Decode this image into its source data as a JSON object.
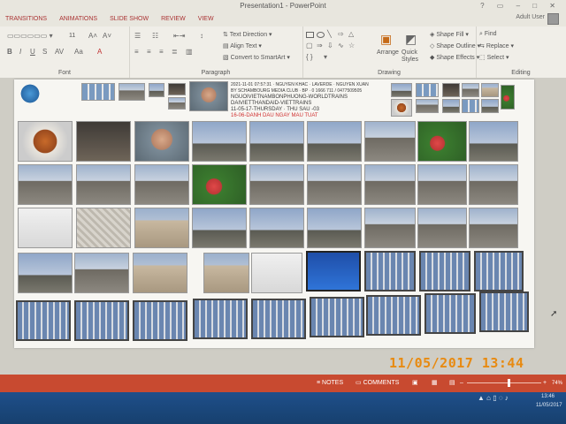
{
  "window": {
    "title": "Presentation1 - PowerPoint",
    "controls": "? ▭ – □ ✕",
    "user": "Adult User"
  },
  "ribbon_tabs": [
    "TRANSITIONS",
    "ANIMATIONS",
    "SLIDE SHOW",
    "REVIEW",
    "VIEW"
  ],
  "ribbon": {
    "font_label": "Font",
    "font_size": "11",
    "paragraph_label": "Paragraph",
    "text_direction": "Text Direction",
    "align_text": "Align Text",
    "convert_smartart": "Convert to SmartArt",
    "drawing_label": "Drawing",
    "arrange": "Arrange",
    "quick_styles": "Quick Styles",
    "shape_fill": "Shape Fill",
    "shape_outline": "Shape Outline",
    "shape_effects": "Shape Effects",
    "editing_label": "Editing",
    "find": "Find",
    "replace": "Replace",
    "select": "Select"
  },
  "slide_text": {
    "line1": "2021-11-01 07:57:31 · NGUYEN KHAC · LAVERDE · NGUYEN XUAN",
    "line2": "BY SCHAMBOURG MEDIA CLUB · BP · 0 1666 711 / 0477509505",
    "line3": "NGUOIVIETNAMBONPHUONG-WORLDTRAINS",
    "line4": "DAIVIETTHANDAID-VIETTRAINS",
    "line5": "11-05-17-THURSDAY · THU SAU -03",
    "line6": "16-06-DANH DAU NGAY MAU TUAT"
  },
  "status_bar": {
    "notes": "NOTES",
    "comments": "COMMENTS",
    "zoom": "74%"
  },
  "taskbar": {
    "time": "13:46",
    "date": "11/05/2017"
  },
  "camera_timestamp": "11/05/2017  13:44",
  "colors": {
    "accent": "#c84a30",
    "tab_text": "#a33333",
    "timestamp": "#e88a10",
    "taskbar": "#1e4f8a"
  }
}
